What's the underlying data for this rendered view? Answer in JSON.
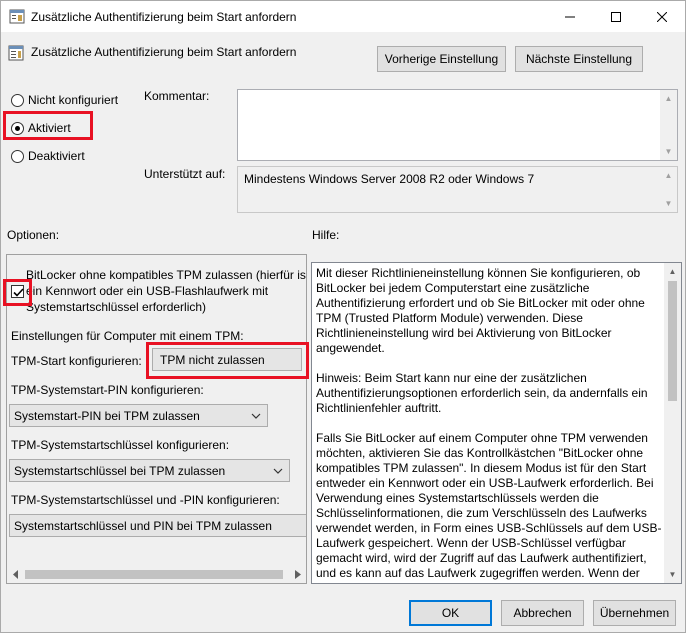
{
  "window": {
    "title": "Zusätzliche Authentifizierung beim Start anfordern"
  },
  "header": {
    "policy_title": "Zusätzliche Authentifizierung beim Start anfordern",
    "prev_button": "Vorherige Einstellung",
    "next_button": "Nächste Einstellung"
  },
  "state": {
    "options": [
      "Nicht konfiguriert",
      "Aktiviert",
      "Deaktiviert"
    ],
    "selected": "Aktiviert"
  },
  "comment": {
    "label": "Kommentar:",
    "value": ""
  },
  "supported": {
    "label": "Unterstützt auf:",
    "value": "Mindestens Windows Server 2008 R2 oder Windows 7"
  },
  "sections": {
    "options_label": "Optionen:",
    "help_label": "Hilfe:"
  },
  "options": {
    "no_tpm_checkbox": {
      "checked": true,
      "lines": [
        "BitLocker ohne kompatibles TPM zulassen (hierfür ist",
        "ein Kennwort oder ein USB-Flashlaufwerk mit",
        "Systemstartschlüssel erforderlich)"
      ]
    },
    "tpm_settings_heading": "Einstellungen für Computer mit einem TPM:",
    "tpm_start_label": "TPM-Start konfigurieren:",
    "tpm_start_value": "TPM nicht zulassen",
    "pin_label": "TPM-Systemstart-PIN konfigurieren:",
    "pin_value": "Systemstart-PIN bei TPM zulassen",
    "key_label": "TPM-Systemstartschlüssel konfigurieren:",
    "key_value": "Systemstartschlüssel bei TPM zulassen",
    "key_pin_label": "TPM-Systemstartschlüssel und -PIN konfigurieren:",
    "key_pin_value": "Systemstartschlüssel und PIN bei TPM zulassen"
  },
  "help": {
    "paragraphs": [
      "Mit dieser Richtlinieneinstellung können Sie konfigurieren, ob BitLocker bei jedem Computerstart eine zusätzliche Authentifizierung erfordert und ob Sie BitLocker mit oder ohne TPM (Trusted Platform Module) verwenden. Diese Richtlinieneinstellung wird bei Aktivierung von BitLocker angewendet.",
      "Hinweis: Beim Start kann nur eine der zusätzlichen Authentifizierungsoptionen erforderlich sein, da andernfalls ein Richtlinienfehler auftritt.",
      "Falls Sie BitLocker auf einem Computer ohne TPM verwenden möchten, aktivieren Sie das Kontrollkästchen \"BitLocker ohne kompatibles TPM zulassen\". In diesem Modus ist für den Start entweder ein Kennwort oder ein USB-Laufwerk erforderlich. Bei Verwendung eines Systemstartschlüssels werden die Schlüsselinformationen, die zum Verschlüsseln des Laufwerks verwendet werden, in Form eines USB-Schlüssels auf dem USB-Laufwerk gespeichert. Wenn der USB-Schlüssel verfügbar gemacht wird, wird der Zugriff auf das Laufwerk authentifiziert, und es kann auf das Laufwerk zugegriffen werden. Wenn der"
    ]
  },
  "footer": {
    "ok": "OK",
    "cancel": "Abbrechen",
    "apply": "Übernehmen"
  },
  "colors": {
    "highlight": "#e81123",
    "accent": "#0078d7"
  }
}
